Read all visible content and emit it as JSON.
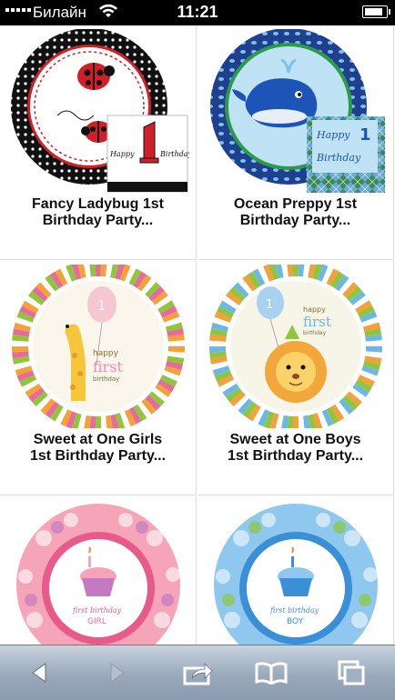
{
  "status_bar": {
    "carrier": "Билайн",
    "time": "11:21",
    "battery_level": 0.85
  },
  "products": [
    {
      "title": "Fancy Ladybug 1st Birthday Party...",
      "title_line1": "Fancy Ladybug 1st",
      "title_line2": "Birthday Party...",
      "card_text": "Happy 1st Birthday",
      "theme": "ladybug"
    },
    {
      "title": "Ocean Preppy 1st Birthday Party...",
      "title_line1": "Ocean Preppy 1st",
      "title_line2": "Birthday Party...",
      "card_text": "Happy 1st Birthday",
      "theme": "whale"
    },
    {
      "title": "Sweet at One Girls 1st Birthday Party...",
      "title_line1": "Sweet at One Girls",
      "title_line2": "1st Birthday Party...",
      "card_text": "happy first birthday",
      "theme": "giraffe"
    },
    {
      "title": "Sweet at One Boys 1st Birthday Party...",
      "title_line1": "Sweet at One Boys",
      "title_line2": "1st Birthday Party...",
      "card_text": "happy first birthday",
      "theme": "lion"
    },
    {
      "title": "",
      "card_text": "first birthday GIRL",
      "theme": "cupcake-girl"
    },
    {
      "title": "",
      "card_text": "first birthday BOY",
      "theme": "cupcake-boy"
    }
  ],
  "toolbar": {
    "back_icon": "back-arrow-icon",
    "forward_icon": "forward-arrow-icon",
    "share_icon": "share-icon",
    "bookmarks_icon": "bookmarks-icon",
    "tabs_icon": "tabs-icon"
  },
  "colors": {
    "toolbar_top": "#c9d3df",
    "toolbar_bottom": "#8b9bb0",
    "title_text": "#111111",
    "divider": "#dcdcdc"
  }
}
